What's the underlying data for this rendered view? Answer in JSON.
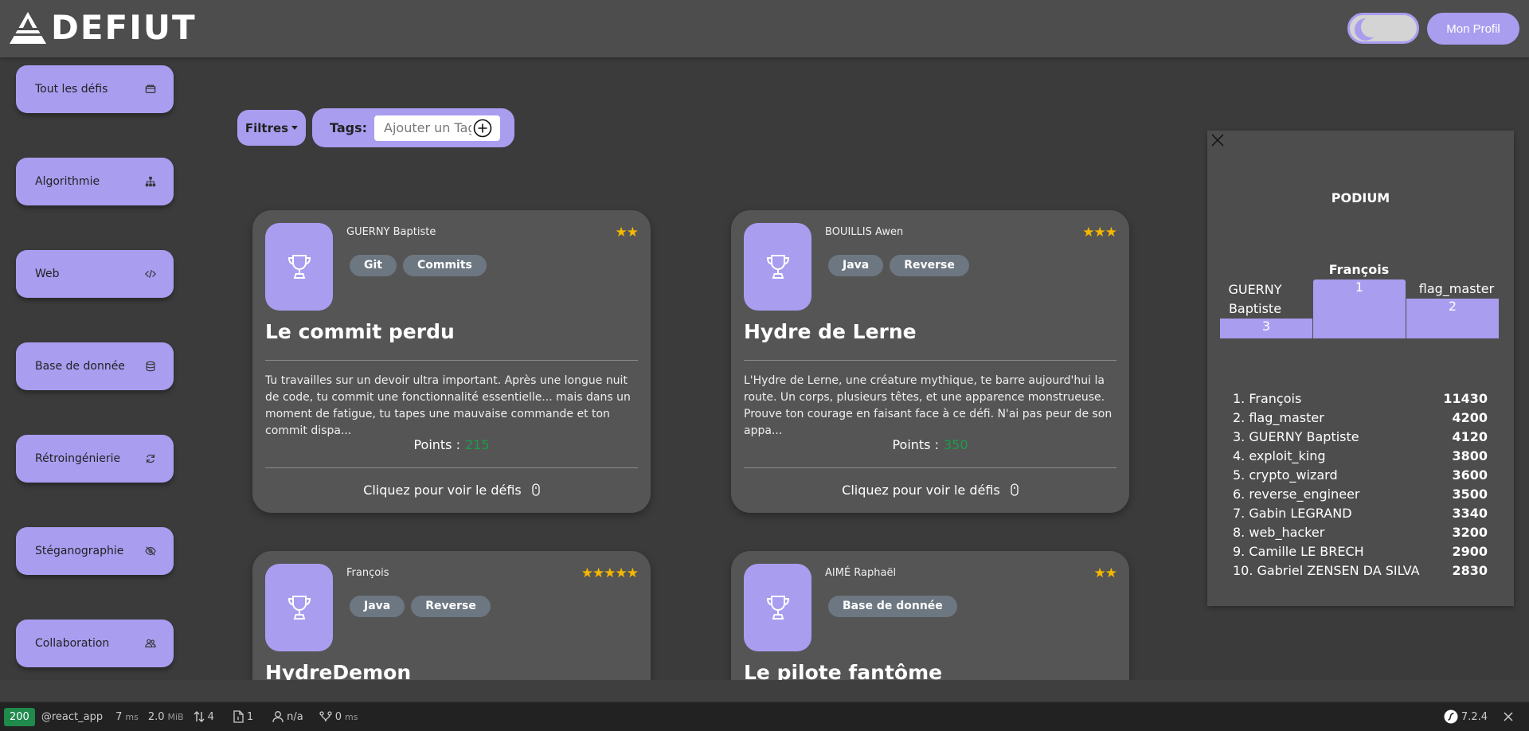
{
  "header": {
    "logo_text": "DEFIUT",
    "profile_label": "Mon Profil",
    "theme_toggle": "dark-mode-toggle"
  },
  "sidebar": {
    "items": [
      {
        "label": "Tout les défis",
        "icon": "folder-icon"
      },
      {
        "label": "Algorithmie",
        "icon": "hierarchy-icon"
      },
      {
        "label": "Web",
        "icon": "code-icon"
      },
      {
        "label": "Base de donnée",
        "icon": "database-icon"
      },
      {
        "label": "Rétroingénierie",
        "icon": "refresh-icon"
      },
      {
        "label": "Stéganographie",
        "icon": "eye-slash-icon"
      },
      {
        "label": "Collaboration",
        "icon": "people-icon"
      }
    ]
  },
  "filters": {
    "filter_label": "Filtres",
    "tags_label": "Tags:",
    "tags_placeholder": "Ajouter un Tag"
  },
  "cards": [
    {
      "author": "GUERNY Baptiste",
      "stars": "★★",
      "tags": [
        "Git",
        "Commits"
      ],
      "title": "Le commit perdu",
      "description": "Tu travailles sur un devoir ultra important. Après une longue nuit de code, tu commit une fonctionnalité essentielle... mais dans un moment de fatigue, tu tapes une mauvaise commande et ton commit dispa...",
      "points_label": "Points :",
      "points": "215",
      "cta": "Cliquez pour voir le défis"
    },
    {
      "author": "BOUILLIS Awen",
      "stars": "★★★",
      "tags": [
        "Java",
        "Reverse"
      ],
      "title": "Hydre de Lerne",
      "description": "L'Hydre de Lerne, une créature mythique, te barre aujourd'hui la route. Un corps, plusieurs têtes, et une apparence monstrueuse. Prouve ton courage en faisant face à ce défi. N'ai pas peur de son appa...",
      "points_label": "Points :",
      "points": "350",
      "cta": "Cliquez pour voir le défis"
    },
    {
      "author": "François",
      "stars": "★★★★★",
      "tags": [
        "Java",
        "Reverse"
      ],
      "title": "HydreDemon"
    },
    {
      "author": "AIMÉ Raphaël",
      "stars": "★★",
      "tags": [
        "Base de donnée"
      ],
      "title": "Le pilote fantôme"
    }
  ],
  "podium": {
    "title": "PODIUM",
    "first": {
      "name": "François",
      "rank": "1"
    },
    "second": {
      "name": "flag_master",
      "rank": "2"
    },
    "third": {
      "name": "GUERNY Baptiste",
      "rank": "3"
    },
    "ranking": [
      {
        "label": "1. François",
        "score": "11430"
      },
      {
        "label": "2. flag_master",
        "score": "4200"
      },
      {
        "label": "3. GUERNY Baptiste",
        "score": "4120"
      },
      {
        "label": "4. exploit_king",
        "score": "3800"
      },
      {
        "label": "5. crypto_wizard",
        "score": "3600"
      },
      {
        "label": "6. reverse_engineer",
        "score": "3500"
      },
      {
        "label": "7. Gabin LEGRAND",
        "score": "3340"
      },
      {
        "label": "8. web_hacker",
        "score": "3200"
      },
      {
        "label": "9. Camille LE BRECH",
        "score": "2900"
      },
      {
        "label": "10. Gabriel ZENSEN DA SILVA",
        "score": "2830"
      }
    ]
  },
  "debug_bar": {
    "status": "200",
    "route": "@react_app",
    "time_value": "7",
    "time_unit": "ms",
    "memory_value": "2.0",
    "memory_unit": "MiB",
    "requests": "4",
    "files": "1",
    "user": "n/a",
    "events_value": "0",
    "events_unit": "ms",
    "version": "7.2.4",
    "colors": {
      "status_bg": "#1f8a4c"
    }
  },
  "colors": {
    "accent": "#a99df0",
    "background": "#3b3b3b",
    "card": "#555555",
    "tag": "#6d7781",
    "star": "#f5b800",
    "points": "#1a9e4a"
  }
}
